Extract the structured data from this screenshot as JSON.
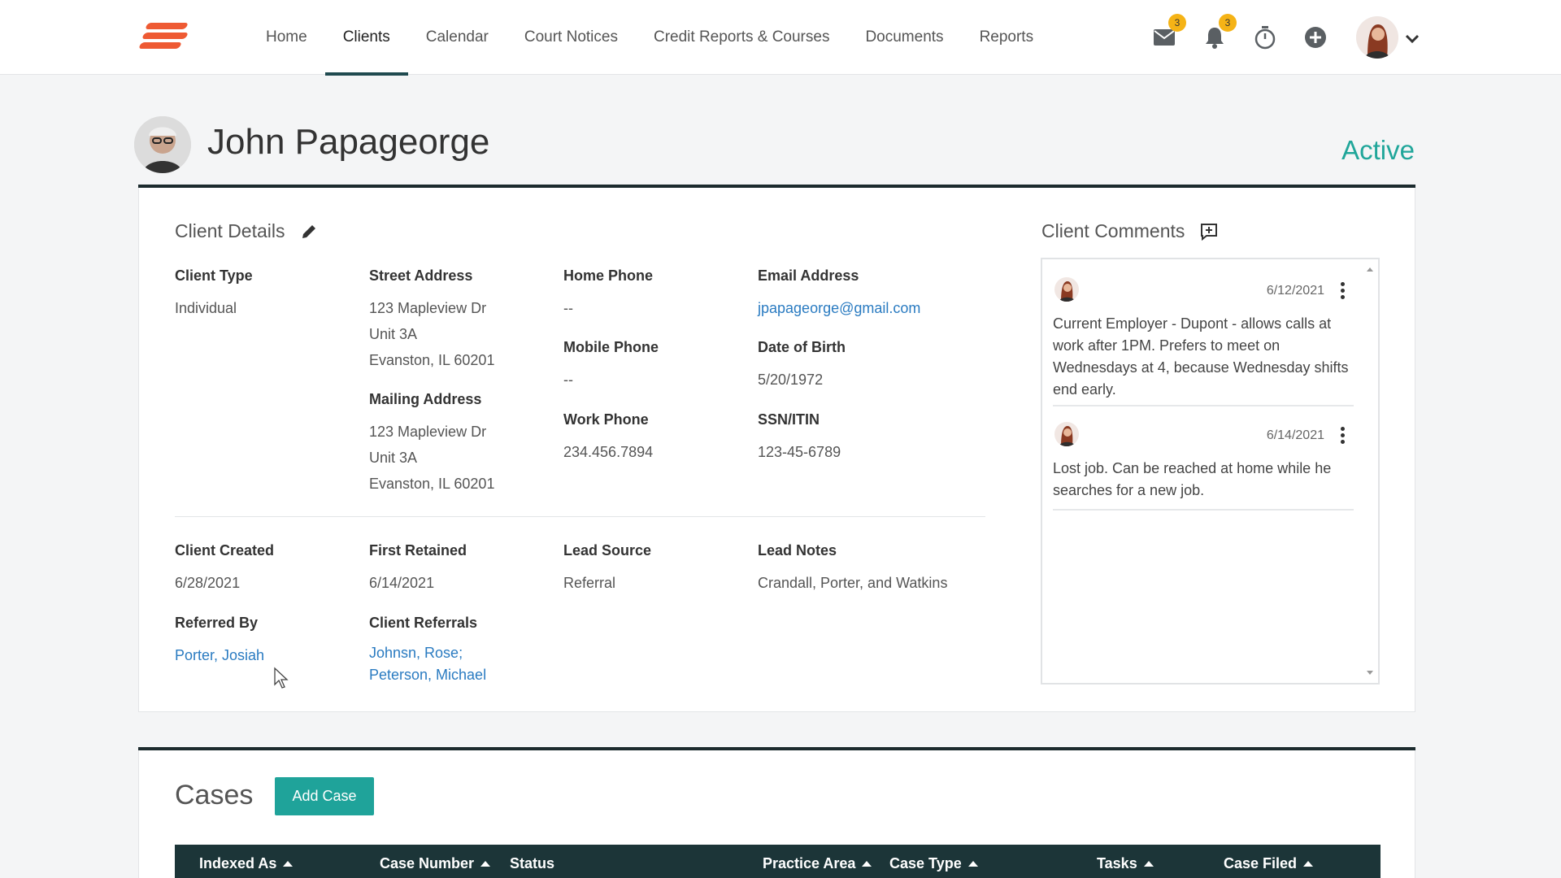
{
  "nav": {
    "items": [
      {
        "label": "Home",
        "active": false
      },
      {
        "label": "Clients",
        "active": true
      },
      {
        "label": "Calendar",
        "active": false
      },
      {
        "label": "Court Notices",
        "active": false
      },
      {
        "label": "Credit Reports & Courses",
        "active": false
      },
      {
        "label": "Documents",
        "active": false
      },
      {
        "label": "Reports",
        "active": false
      }
    ],
    "mail_badge": "3",
    "notification_badge": "3",
    "accent_color": "#1f4a4f",
    "logo_color": "#ee5a33",
    "badge_color": "#f5b316"
  },
  "client": {
    "name": "John Papageorge",
    "status": "Active",
    "status_color": "#20a69a"
  },
  "details": {
    "title": "Client Details",
    "client_type": {
      "label": "Client Type",
      "value": "Individual"
    },
    "street_address": {
      "label": "Street Address",
      "line1": "123 Mapleview Dr",
      "line2": "Unit 3A",
      "line3": "Evanston, IL 60201"
    },
    "mailing_address": {
      "label": "Mailing Address",
      "line1": "123 Mapleview Dr",
      "line2": "Unit 3A",
      "line3": "Evanston, IL 60201"
    },
    "home_phone": {
      "label": "Home Phone",
      "value": "--"
    },
    "mobile_phone": {
      "label": "Mobile Phone",
      "value": "--"
    },
    "work_phone": {
      "label": "Work Phone",
      "value": "234.456.7894"
    },
    "email": {
      "label": "Email Address",
      "value": "jpapageorge@gmail.com"
    },
    "dob": {
      "label": "Date of Birth",
      "value": "5/20/1972"
    },
    "ssn": {
      "label": "SSN/ITIN",
      "value": "123-45-6789"
    },
    "client_created": {
      "label": "Client Created",
      "value": "6/28/2021"
    },
    "first_retained": {
      "label": "First Retained",
      "value": "6/14/2021"
    },
    "lead_source": {
      "label": "Lead Source",
      "value": "Referral"
    },
    "lead_notes": {
      "label": "Lead Notes",
      "value": "Crandall, Porter, and Watkins"
    },
    "referred_by": {
      "label": "Referred By",
      "value": "Porter, Josiah"
    },
    "client_referrals": {
      "label": "Client Referrals",
      "items": [
        "Johnsn, Rose;",
        "Peterson, Michael"
      ]
    }
  },
  "comments": {
    "title": "Client Comments",
    "items": [
      {
        "date": "6/12/2021",
        "text": "Current Employer  - Dupont - allows calls at work after 1PM. Prefers to meet on Wednesdays at 4, because Wednesday shifts end early."
      },
      {
        "date": "6/14/2021",
        "text": "Lost job. Can be reached at home while he searches for a new job."
      }
    ]
  },
  "cases": {
    "title": "Cases",
    "add_label": "Add Case",
    "button_color": "#1fa39a",
    "header_color": "#1c3538",
    "columns": [
      {
        "label": "Indexed As",
        "sortable": true
      },
      {
        "label": "Case Number",
        "sortable": true
      },
      {
        "label": "Status",
        "sortable": false
      },
      {
        "label": "Practice Area",
        "sortable": true
      },
      {
        "label": "Case Type",
        "sortable": true
      },
      {
        "label": "Tasks",
        "sortable": true
      },
      {
        "label": "Case Filed",
        "sortable": true
      }
    ]
  }
}
